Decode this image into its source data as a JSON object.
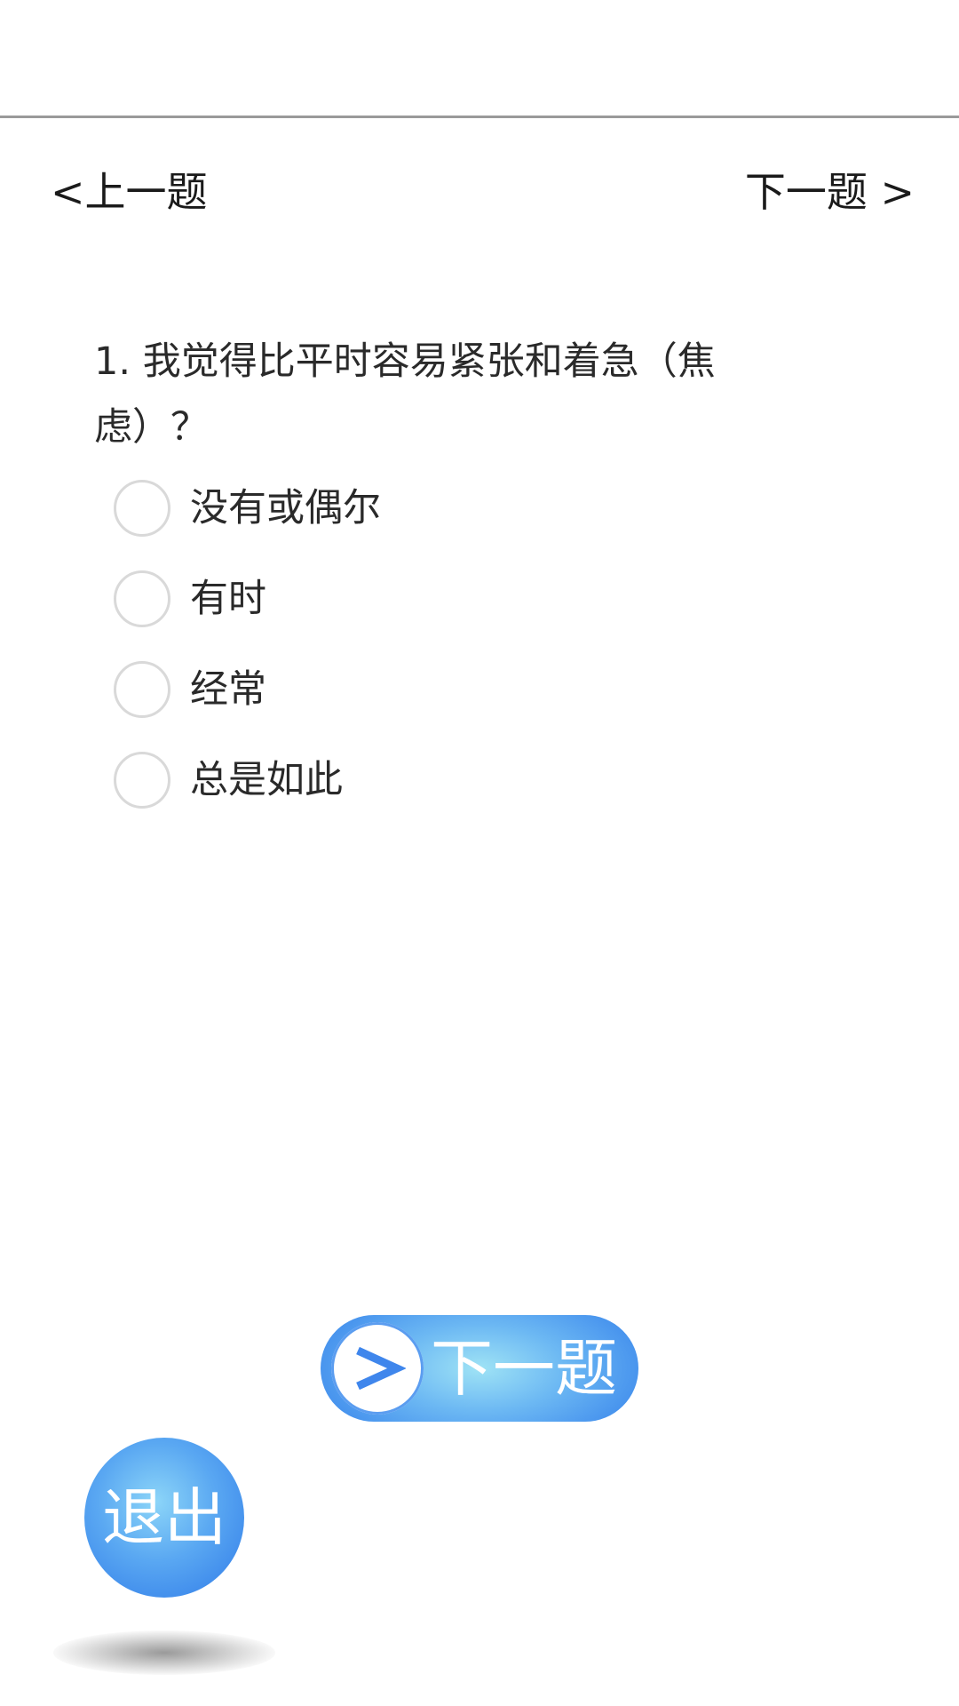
{
  "nav": {
    "prev_label": "<上一题",
    "next_label": "下一题 >"
  },
  "question": {
    "text": "1. 我觉得比平时容易紧张和着急（焦虑）？",
    "options": [
      {
        "label": "没有或偶尔",
        "selected": false
      },
      {
        "label": "有时",
        "selected": false
      },
      {
        "label": "经常",
        "selected": false
      },
      {
        "label": "总是如此",
        "selected": false
      }
    ]
  },
  "buttons": {
    "next_label": "下一题",
    "next_icon": "chevron-right-icon",
    "exit_label": "退出"
  },
  "colors": {
    "accent": "#3a86ec",
    "accent_light": "#9fe3f5",
    "divider": "#9a9a9a"
  }
}
